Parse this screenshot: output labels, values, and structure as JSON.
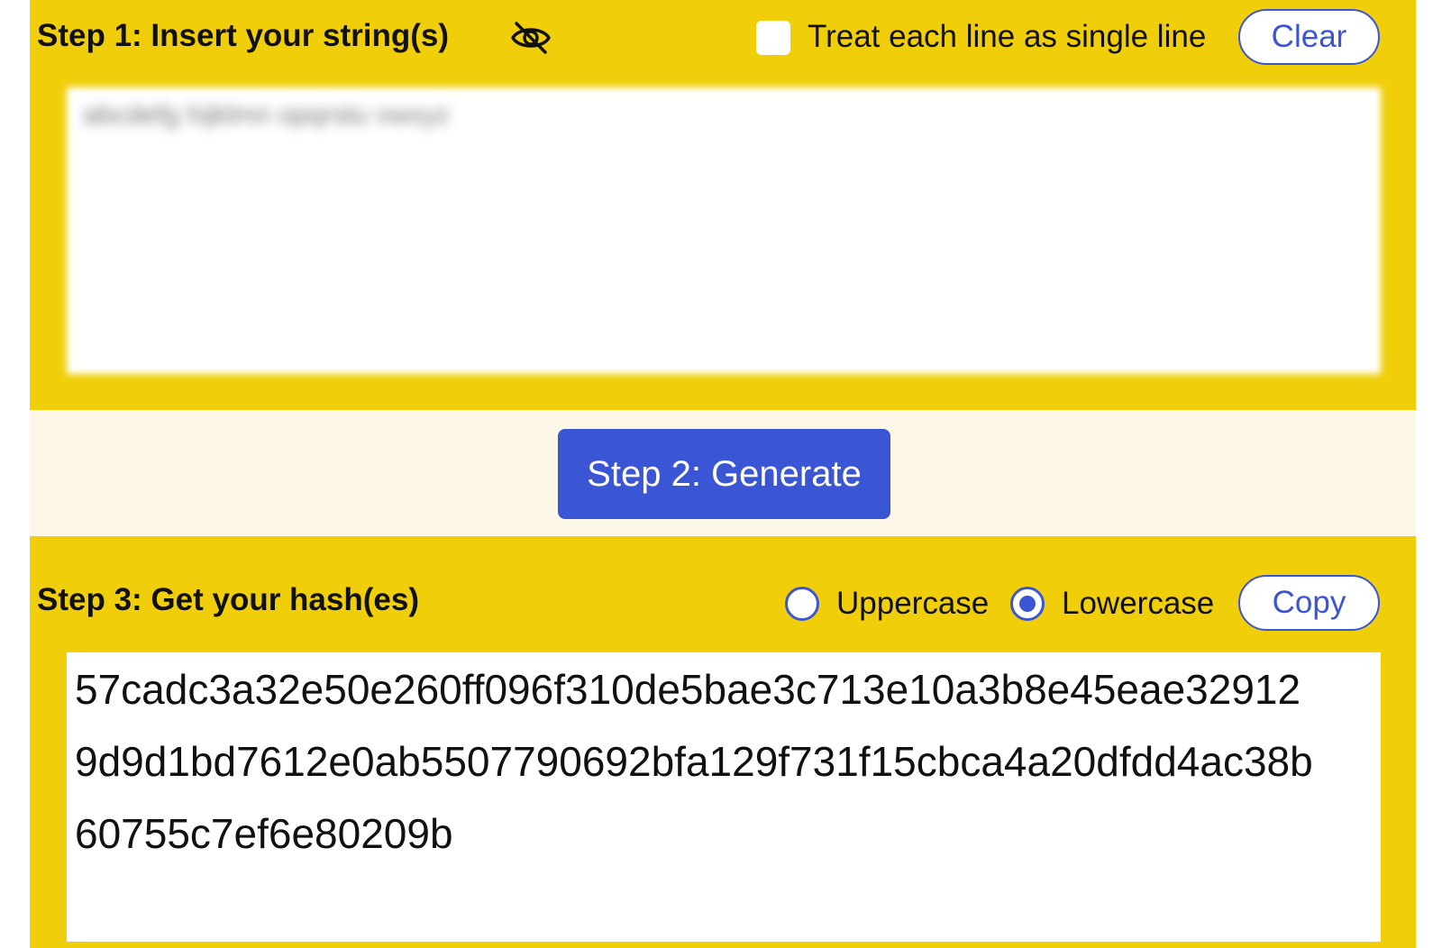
{
  "step1": {
    "heading": "Step 1: Insert your string(s)",
    "visibility_icon": "eye-off-icon",
    "single_line_label": "Treat each line as single line",
    "single_line_checked": false,
    "clear_label": "Clear",
    "input_text_blurred": "abcdefg hijklmn opqrstu vwxyz"
  },
  "step2": {
    "generate_label": "Step 2: Generate"
  },
  "step3": {
    "heading": "Step 3: Get your hash(es)",
    "uppercase_label": "Uppercase",
    "lowercase_label": "Lowercase",
    "selected_case": "Lowercase",
    "copy_label": "Copy",
    "hash_lines": [
      "57cadc3a32e50e260ff096f310de5bae3c713e10a3b8e45eae32912",
      "9d9d1bd7612e0ab5507790692bfa129f731f15cbca4a20dfdd4ac38b",
      "60755c7ef6e80209b"
    ]
  },
  "colors": {
    "panel_yellow": "#f0cf0a",
    "middle_band": "#fcf7e6",
    "accent_blue": "#3a56d4"
  }
}
